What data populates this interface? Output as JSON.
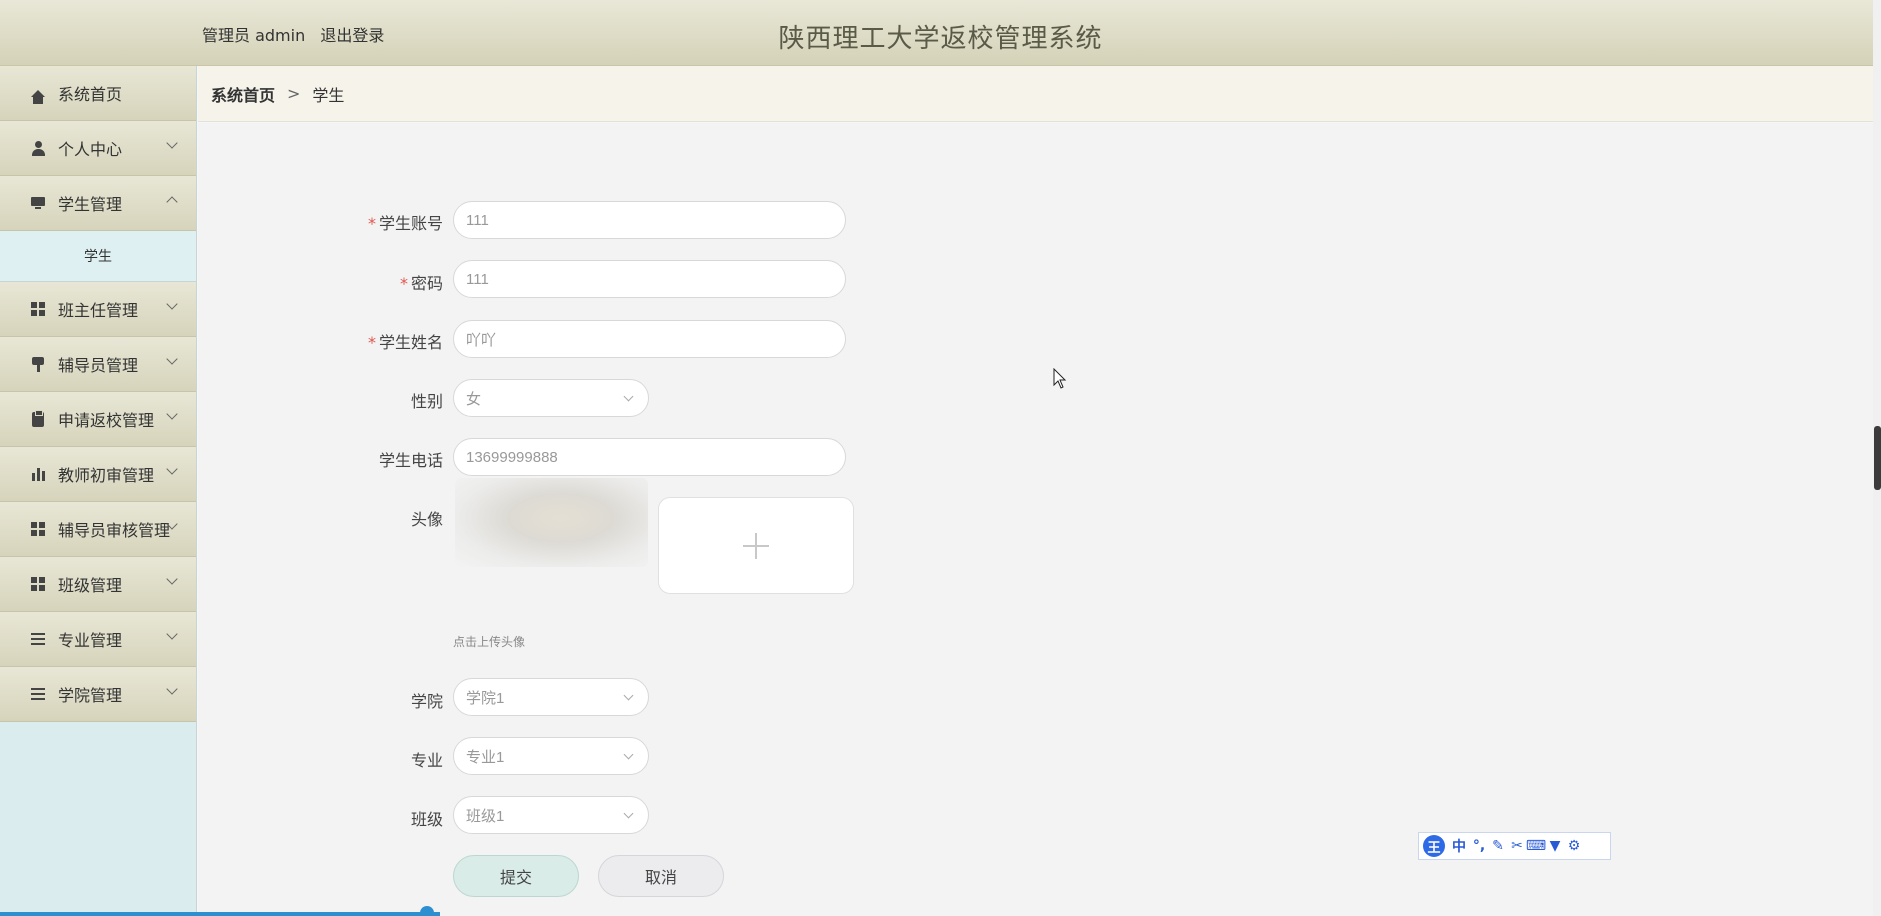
{
  "header": {
    "user_label": "管理员 admin",
    "logout": "退出登录",
    "title": "陕西理工大学返校管理系统"
  },
  "sidebar": {
    "items": [
      {
        "label": "系统首页",
        "icon": "home-icon"
      },
      {
        "label": "个人中心",
        "icon": "user-icon"
      },
      {
        "label": "学生管理",
        "icon": "monitor-icon"
      },
      {
        "label": "班主任管理",
        "icon": "grid-icon"
      },
      {
        "label": "辅导员管理",
        "icon": "pin-icon"
      },
      {
        "label": "申请返校管理",
        "icon": "clipboard-icon"
      },
      {
        "label": "教师初审管理",
        "icon": "bar-chart-icon"
      },
      {
        "label": "辅导员审核管理",
        "icon": "grid-icon"
      },
      {
        "label": "班级管理",
        "icon": "grid-icon"
      },
      {
        "label": "专业管理",
        "icon": "list-icon"
      },
      {
        "label": "学院管理",
        "icon": "list-icon"
      }
    ],
    "sub_item": "学生"
  },
  "breadcrumb": {
    "home": "系统首页",
    "separator": ">",
    "current": "学生"
  },
  "form": {
    "account_label": "学生账号",
    "account_value": "111",
    "password_label": "密码",
    "password_value": "111",
    "name_label": "学生姓名",
    "name_value": "吖吖",
    "gender_label": "性别",
    "gender_value": "女",
    "phone_label": "学生电话",
    "phone_value": "13699999888",
    "avatar_label": "头像",
    "upload_hint": "点击上传头像",
    "college_label": "学院",
    "college_value": "学院1",
    "major_label": "专业",
    "major_value": "专业1",
    "class_label": "班级",
    "class_value": "班级1",
    "required_mark": "*",
    "submit": "提交",
    "cancel": "取消"
  },
  "ime": {
    "logo": "王",
    "mode": "中"
  }
}
